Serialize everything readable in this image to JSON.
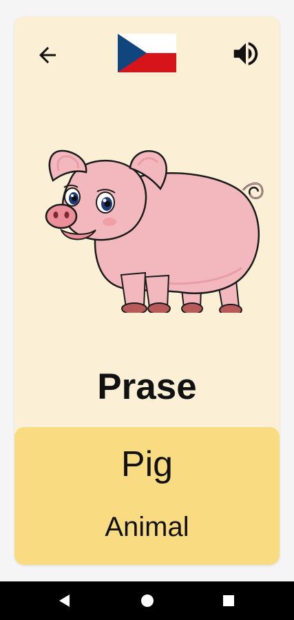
{
  "card": {
    "word": "Prase",
    "translation": "Pig",
    "category": "Animal"
  },
  "flag": {
    "country": "Czech Republic",
    "colors": {
      "white": "#ffffff",
      "red": "#d7141a",
      "blue": "#11457e"
    }
  },
  "icons": {
    "back": "arrow-back-icon",
    "sound": "speaker-icon",
    "nav_back": "triangle-back-icon",
    "nav_home": "circle-home-icon",
    "nav_recents": "square-recents-icon"
  },
  "colors": {
    "card_background": "#fbf0d6",
    "translation_panel": "#f9db82",
    "navbar": "#000000"
  }
}
